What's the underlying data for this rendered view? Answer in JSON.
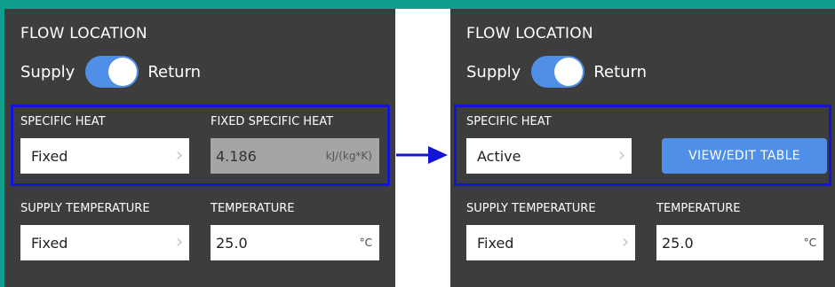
{
  "colors": {
    "teal": "#0f9f8c",
    "panel": "#3d3d3d",
    "accent": "#4f8fe8",
    "highlight": "#1414d8"
  },
  "left": {
    "title": "FLOW LOCATION",
    "toggle": {
      "left_label": "Supply",
      "right_label": "Return",
      "state": "on"
    },
    "specific_heat": {
      "label": "SPECIFIC HEAT",
      "value": "Fixed"
    },
    "fixed_specific_heat": {
      "label": "FIXED SPECIFIC HEAT",
      "value": "4.186",
      "unit": "kJ/(kg*K)"
    },
    "supply_temperature": {
      "label": "SUPPLY TEMPERATURE",
      "value": "Fixed"
    },
    "temperature": {
      "label": "TEMPERATURE",
      "value": "25.0",
      "unit": "°C"
    }
  },
  "right": {
    "title": "FLOW LOCATION",
    "toggle": {
      "left_label": "Supply",
      "right_label": "Return",
      "state": "on"
    },
    "specific_heat": {
      "label": "SPECIFIC HEAT",
      "value": "Active"
    },
    "view_edit_button": "VIEW/EDIT TABLE",
    "supply_temperature": {
      "label": "SUPPLY TEMPERATURE",
      "value": "Fixed"
    },
    "temperature": {
      "label": "TEMPERATURE",
      "value": "25.0",
      "unit": "°C"
    }
  },
  "icons": {
    "transition_arrow": "arrow-right-icon",
    "chevron": "chevron-right-icon"
  }
}
